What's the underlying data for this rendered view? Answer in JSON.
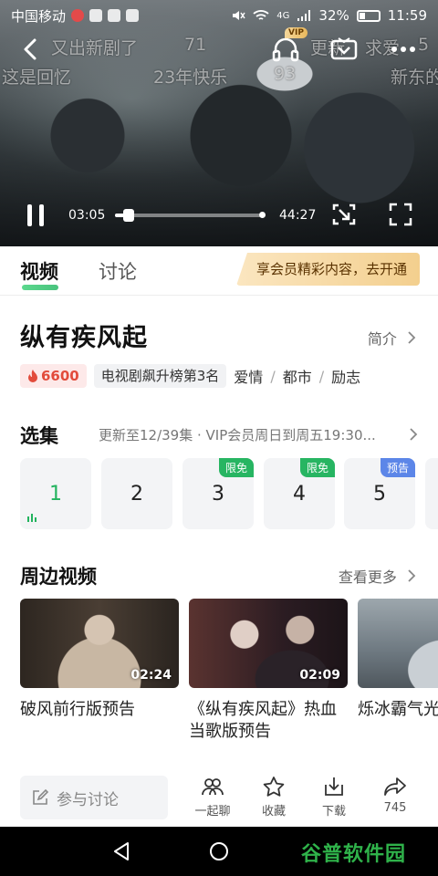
{
  "status_bar": {
    "carrier": "中国移动",
    "network": "4G",
    "battery": "32%",
    "time": "11:59"
  },
  "player": {
    "current_time": "03:05",
    "total_time": "44:27",
    "progress": 0.07,
    "hd_badge": "VIP",
    "danmu": [
      "又出新剧了",
      "71",
      "这是回忆",
      "23年快乐",
      "93",
      "新东的",
      "更新",
      "求爱",
      "5"
    ]
  },
  "tabs": {
    "video": "视频",
    "discussion": "讨论",
    "vip_banner": "享会员精彩内容，去开通"
  },
  "show": {
    "title": "纵有疾风起",
    "intro": "简介",
    "heat": "6600",
    "rank": "电视剧飙升榜第3名",
    "genres": [
      "爱情",
      "都市",
      "励志"
    ],
    "genre_separator": "/"
  },
  "episodes": {
    "heading": "选集",
    "update_info": "更新至12/39集 · VIP会员周日到周五19:30...",
    "items": [
      {
        "number": "1",
        "badge": ""
      },
      {
        "number": "2",
        "badge": ""
      },
      {
        "number": "3",
        "badge": "限免"
      },
      {
        "number": "4",
        "badge": "限免"
      },
      {
        "number": "5",
        "badge": "预告"
      }
    ]
  },
  "related": {
    "heading": "周边视频",
    "more": "查看更多",
    "items": [
      {
        "title": "破风前行版预告",
        "duration": "02:24"
      },
      {
        "title": "《纵有疾风起》热血当歌版预告",
        "duration": "02:09"
      },
      {
        "title": "烁冰霸气光",
        "duration": ""
      }
    ]
  },
  "bottom_bar": {
    "comment_placeholder": "参与讨论",
    "watch_together": "一起聊",
    "favorite": "收藏",
    "download": "下载",
    "share_count": "745"
  },
  "watermark": "谷普软件园",
  "colors": {
    "accent_green": "#22b35e",
    "heat_red": "#e24b3b",
    "vip_gold": "#f3cf8e",
    "preview_blue": "#5c86e8"
  }
}
